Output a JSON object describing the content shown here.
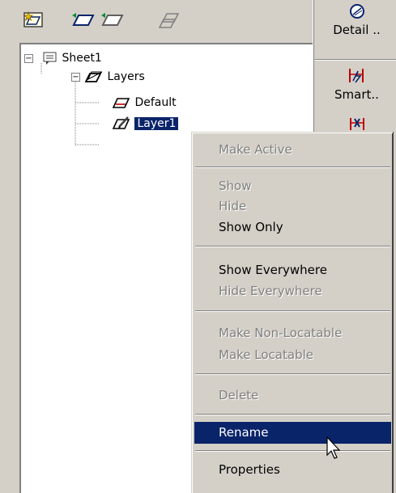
{
  "toolbar": {
    "buttons": [
      {
        "icon": "new-layer-icon"
      },
      {
        "icon": "activate-layer-icon"
      },
      {
        "icon": "deactivate-layer-icon"
      },
      {
        "icon": "copy-layer-icon"
      }
    ]
  },
  "tree": {
    "sheet_label": "Sheet1",
    "layers_label": "Layers",
    "default_label": "Default",
    "layer1_label": "Layer1",
    "sheet_expander": "−",
    "layers_expander": "−"
  },
  "side_strip": {
    "detail_label": "Detail ..",
    "smart_label": "Smart.."
  },
  "context_menu": {
    "items": [
      {
        "label": "Make Active",
        "enabled": false
      },
      {
        "label": "Show",
        "enabled": false
      },
      {
        "label": "Hide",
        "enabled": false
      },
      {
        "label": "Show Only",
        "enabled": true
      },
      {
        "label": "Show Everywhere",
        "enabled": true
      },
      {
        "label": "Hide Everywhere",
        "enabled": false
      },
      {
        "label": "Make Non-Locatable",
        "enabled": false
      },
      {
        "label": "Make Locatable",
        "enabled": false
      },
      {
        "label": "Delete",
        "enabled": false
      },
      {
        "label": "Rename",
        "enabled": true,
        "highlighted": true
      },
      {
        "label": "Properties",
        "enabled": true
      }
    ]
  },
  "colors": {
    "selection": "#0a246a",
    "face": "#d4d0c8",
    "disabled_text": "#808080"
  }
}
